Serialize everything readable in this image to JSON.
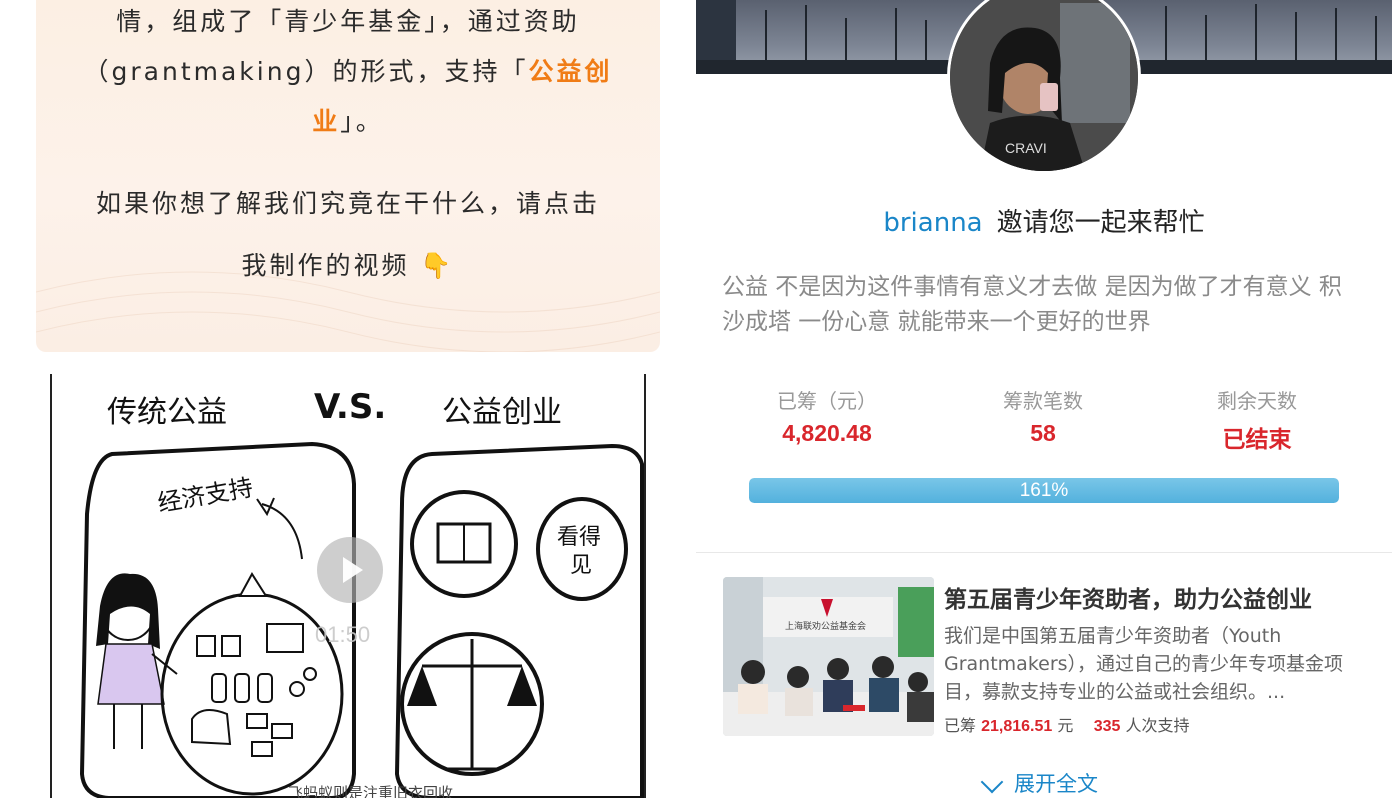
{
  "article": {
    "line1": "情，组成了「青少年基金」，通过资助",
    "line2_prefix": "（grantmaking）的形式，支持「",
    "line2_highlight": "公益创",
    "line3_highlight": "业",
    "line3_suffix": "」。",
    "line4": "如果你想了解我们究竟在干什么，请点击",
    "line5": "我制作的视频",
    "line5_emoji": "👇"
  },
  "video": {
    "heading_left": "传统公益",
    "heading_vs": "V.S.",
    "heading_right": "公益创业",
    "bag_label": "经济支持",
    "bubble_text_1": "看得",
    "bubble_text_2": "见",
    "duration": "01:50",
    "subtitle": "飞蚂蚁则是注重旧衣回收"
  },
  "profile": {
    "username": "brianna",
    "invite_text": "邀请您一起来帮忙",
    "description": "公益 不是因为这件事情有意义才去做 是因为做了才有意义 积沙成塔 一份心意 就能带来一个更好的世界"
  },
  "stats": {
    "raised_label": "已筹（元）",
    "raised_value": "4,820.48",
    "count_label": "筹款笔数",
    "count_value": "58",
    "days_label": "剩余天数",
    "days_value": "已结束"
  },
  "progress": {
    "percent_label": "161%",
    "fill_fraction": 1.0
  },
  "project": {
    "title": "第五届青少年资助者，助力公益创业",
    "description": "我们是中国第五届青少年资助者（Youth Grantmakers），通过自己的青少年专项基金项目，募款支持专业的公益或社会组织。...",
    "raised_prefix": "已筹",
    "raised_amount": "21,816.51",
    "raised_unit": "元",
    "supporters_count": "335",
    "supporters_suffix": "人次支持",
    "thumb_sign": "上海联劝公益基金会"
  },
  "expand": {
    "label": "展开全文"
  },
  "colors": {
    "accent_blue": "#1a86c8",
    "accent_red": "#d9262c",
    "highlight_orange": "#f07c16",
    "progress_blue": "#53b1dd"
  }
}
